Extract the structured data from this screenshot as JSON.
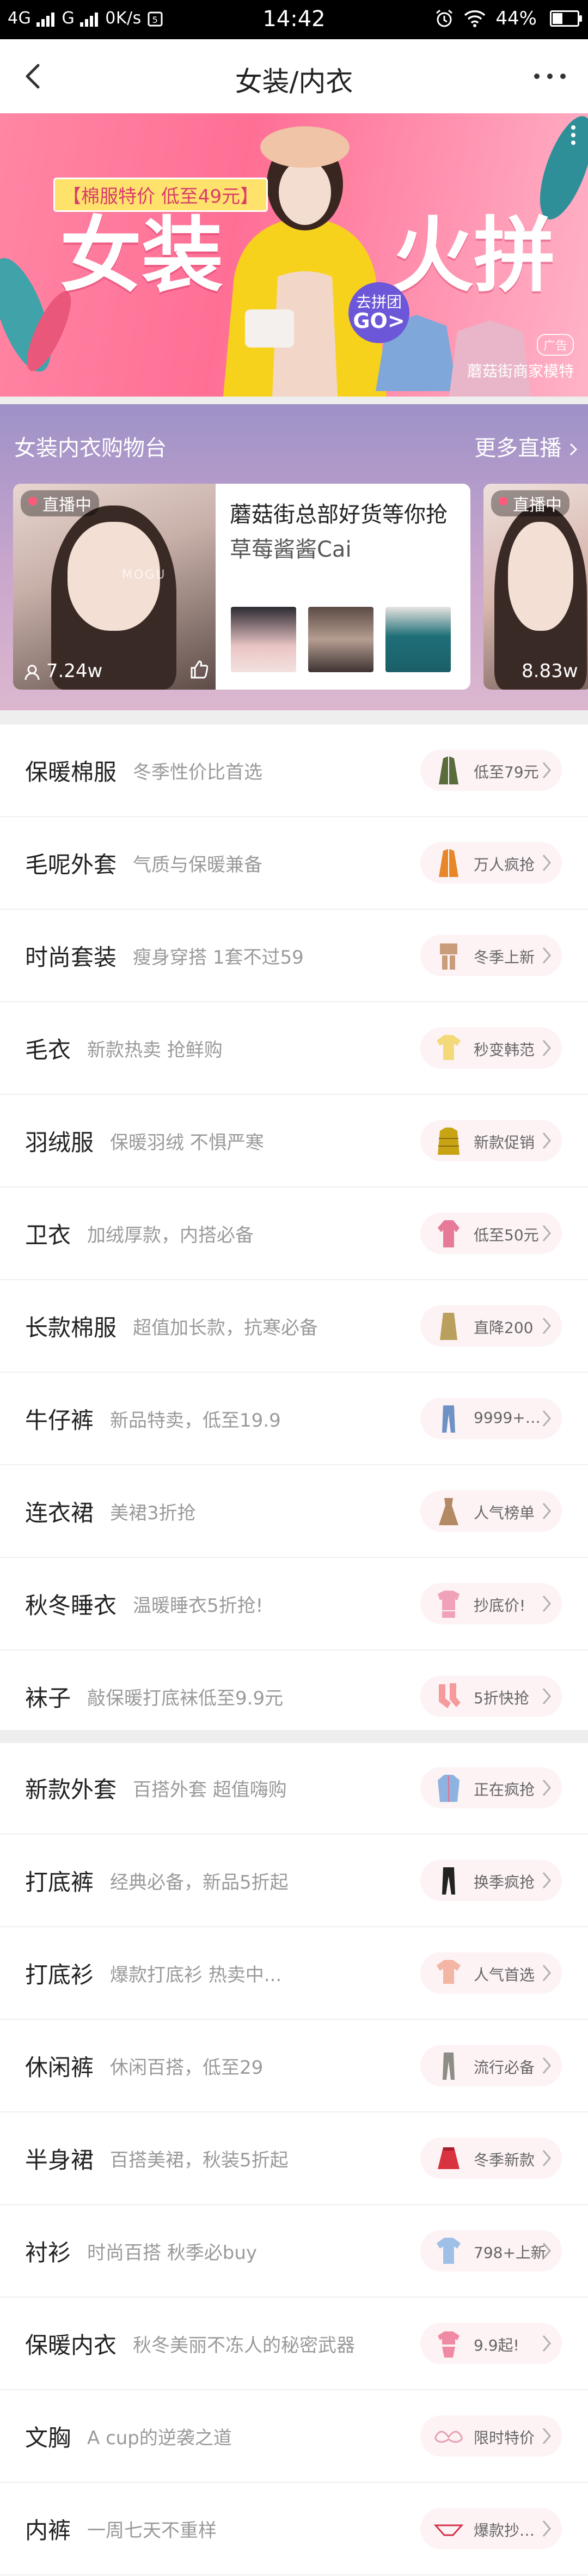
{
  "status_bar": {
    "network_left": "4G",
    "network_right": "G",
    "speed": "0K/s",
    "time": "14:42",
    "battery": "44%",
    "battery_level": 0.44
  },
  "nav": {
    "title": "女装/内衣"
  },
  "banner": {
    "tag": "【棉服特价 低至49元】",
    "big_left": "女装",
    "big_right": "火拼",
    "go_line1": "去拼团",
    "go_line2": "GO>",
    "ad_tag": "广告",
    "caption": "蘑菇街商家模特"
  },
  "live": {
    "title": "女装内衣购物台",
    "more": "更多直播",
    "cards": [
      {
        "badge": "直播中",
        "viewers": "7.24w",
        "title": "蘑菇街总部好货等你抢",
        "host": "草莓酱酱Cai",
        "watermark": "MOGU"
      },
      {
        "badge": "直播中",
        "viewers": "8.83w"
      }
    ]
  },
  "categories_1": [
    {
      "name": "保暖棉服",
      "desc": "冬季性价比首选",
      "tag": "低至79元",
      "icon": "coat-icon",
      "color": "#5a6b3c"
    },
    {
      "name": "毛呢外套",
      "desc": "气质与保暖兼备",
      "tag": "万人疯抢",
      "icon": "coat-icon",
      "color": "#e8862a"
    },
    {
      "name": "时尚套装",
      "desc": "瘦身穿搭 1套不过59",
      "tag": "冬季上新",
      "icon": "outfit-icon",
      "color": "#c99c7a"
    },
    {
      "name": "毛衣",
      "desc": "新款热卖 抢鲜购",
      "tag": "秒变韩范",
      "icon": "sweater-icon",
      "color": "#f3d97a"
    },
    {
      "name": "羽绒服",
      "desc": "保暖羽绒 不惧严寒",
      "tag": "新款促销",
      "icon": "down-jacket-icon",
      "color": "#c8a414"
    },
    {
      "name": "卫衣",
      "desc": "加绒厚款，内搭必备",
      "tag": "低至50元",
      "icon": "hoodie-icon",
      "color": "#e77a98"
    },
    {
      "name": "长款棉服",
      "desc": "超值加长款，抗寒必备",
      "tag": "直降200",
      "icon": "long-coat-icon",
      "color": "#b9a05c"
    },
    {
      "name": "牛仔裤",
      "desc": "新品特卖，低至19.9",
      "tag": "9999+…",
      "icon": "jeans-icon",
      "color": "#6f92c4"
    },
    {
      "name": "连衣裙",
      "desc": "美裙3折抢",
      "tag": "人气榜单",
      "icon": "dress-icon",
      "color": "#b48a64"
    },
    {
      "name": "秋冬睡衣",
      "desc": "温暖睡衣5折抢!",
      "tag": "抄底价!",
      "icon": "pajamas-icon",
      "color": "#f0a3b8"
    },
    {
      "name": "袜子",
      "desc": "敲保暖打底袜低至9.9元",
      "tag": "5折快抢",
      "icon": "socks-icon",
      "color": "#f59b9b"
    }
  ],
  "categories_2": [
    {
      "name": "新款外套",
      "desc": "百搭外套 超值嗨购",
      "tag": "正在疯抢",
      "icon": "jacket-icon",
      "color": "#8fb3e0"
    },
    {
      "name": "打底裤",
      "desc": "经典必备，新品5折起",
      "tag": "换季疯抢",
      "icon": "leggings-icon",
      "color": "#222222"
    },
    {
      "name": "打底衫",
      "desc": "爆款打底衫 热卖中...",
      "tag": "人气首选",
      "icon": "blouse-icon",
      "color": "#f3b6a4"
    },
    {
      "name": "休闲裤",
      "desc": "休闲百搭，低至29",
      "tag": "流行必备",
      "icon": "trousers-icon",
      "color": "#8d8d86"
    },
    {
      "name": "半身裙",
      "desc": "百搭美裙，秋装5折起",
      "tag": "冬季新款",
      "icon": "skirt-icon",
      "color": "#d8333f"
    },
    {
      "name": "衬衫",
      "desc": "时尚百搭 秋季必buy",
      "tag": "798+上新",
      "icon": "shirt-icon",
      "color": "#9fc0e6"
    },
    {
      "name": "保暖内衣",
      "desc": "秋冬美丽不冻人的秘密武器",
      "tag": "9.9起!",
      "icon": "thermal-icon",
      "color": "#f08aa4"
    },
    {
      "name": "文胸",
      "desc": "A cup的逆袭之道",
      "tag": "限时特价",
      "icon": "bra-icon",
      "color": "#e8a0b0"
    },
    {
      "name": "内裤",
      "desc": "一周七天不重样",
      "tag": "爆款抄…",
      "icon": "underwear-icon",
      "color": "#d6334a"
    }
  ]
}
